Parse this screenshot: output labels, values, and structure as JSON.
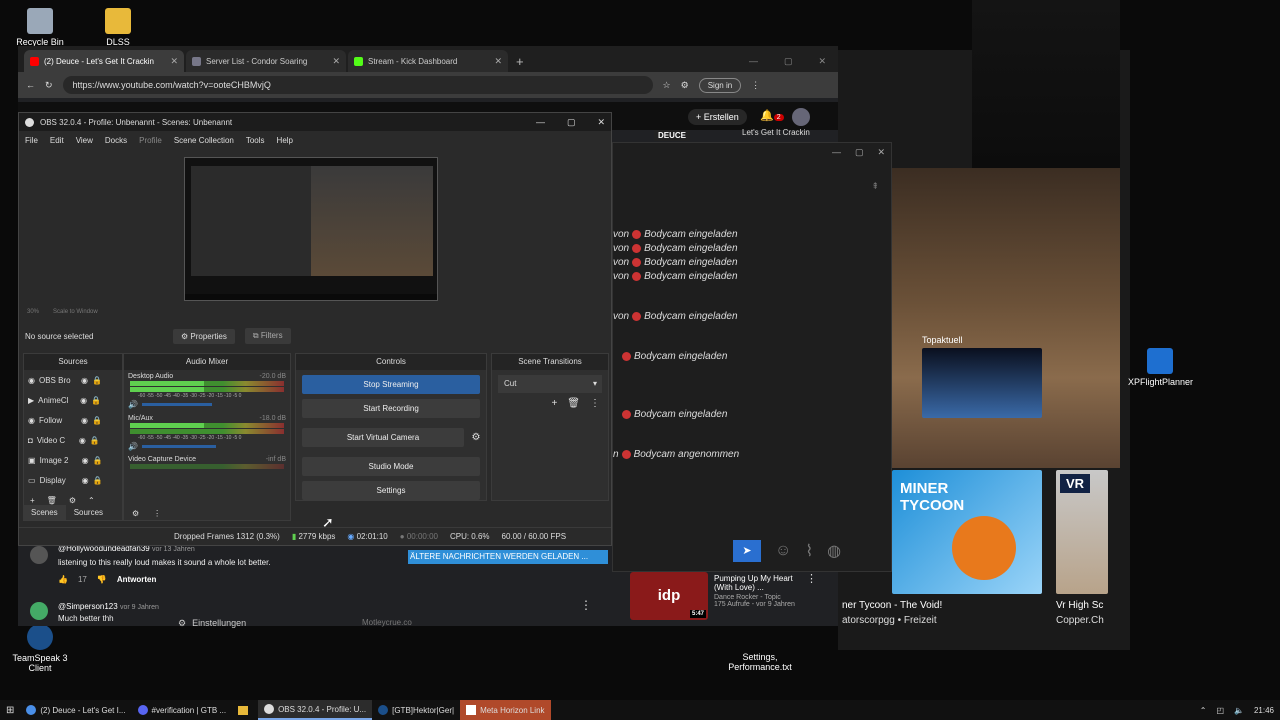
{
  "desktop": {
    "icons": [
      {
        "label": "Recycle Bin"
      },
      {
        "label": "DLSS"
      },
      {
        "label": "XPFlightPlanner"
      },
      {
        "label": "TeamSpeak 3 Client"
      },
      {
        "label": "Settings, Performance.txt"
      }
    ]
  },
  "browser": {
    "tabs": [
      {
        "label": "(2) Deuce - Let's Get It Crackin"
      },
      {
        "label": "Server List - Condor Soaring"
      },
      {
        "label": "Stream - Kick Dashboard"
      }
    ],
    "new_tab": "+",
    "url": "https://www.youtube.com/watch?v=ooteCHBMvjQ",
    "sign_in": "Sign in",
    "create_label": "Erstellen",
    "notif_count": "2",
    "comments": [
      {
        "user": "@Hollywoodundeadfan39",
        "age": "vor 13 Jahren",
        "text": "listening to this really loud makes it sound a whole lot better.",
        "likes": "17",
        "reply": "Antworten"
      },
      {
        "user": "@Simperson123",
        "age": "vor 9 Jahren",
        "text": "Much better thh"
      }
    ],
    "settings_label": "Einstellungen",
    "video_top": {
      "channel": "DEUCE",
      "title": "Let's Get It Crackin"
    },
    "related": {
      "title": "Pumping Up My Heart (With Love) ...",
      "channel": "Dance Rocker - Topic",
      "views": "175 Aufrufe - vor 9 Jahren",
      "duration": "5:47",
      "badge": "idp"
    }
  },
  "obs": {
    "title": "OBS 32.0.4 - Profile: Unbenannt - Scenes: Unbenannt",
    "menu": [
      "File",
      "Edit",
      "View",
      "Docks",
      "Profile",
      "Scene Collection",
      "Tools",
      "Help"
    ],
    "preview_footer": {
      "zoom": "30%",
      "scale": "Scale to Window"
    },
    "no_source": "No source selected",
    "properties": "Properties",
    "filters": "Filters",
    "docks": {
      "sources": "Sources",
      "audio_mixer": "Audio Mixer",
      "controls": "Controls",
      "scene_transitions": "Scene Transitions"
    },
    "sources": [
      {
        "label": "OBS Bro"
      },
      {
        "label": "AnimeCl"
      },
      {
        "label": "Follow"
      },
      {
        "label": "Video C"
      },
      {
        "label": "Image 2"
      },
      {
        "label": "Display"
      }
    ],
    "mixer": [
      {
        "name": "Desktop Audio",
        "db": "-20.0 dB"
      },
      {
        "name": "Mic/Aux",
        "db": "-18.0 dB"
      },
      {
        "name": "Video Capture Device",
        "db": "-inf dB"
      }
    ],
    "meter_scale": "-60 -55 -50 -45 -40 -35 -30 -25 -20 -15 -10 -5 0",
    "controls": {
      "stop_streaming": "Stop Streaming",
      "start_recording": "Start Recording",
      "start_virtual_camera": "Start Virtual Camera",
      "studio_mode": "Studio Mode",
      "settings": "Settings"
    },
    "transition": "Cut",
    "tabs": {
      "scenes": "Scenes",
      "sources": "Sources"
    },
    "status": {
      "dropped": "Dropped Frames 1312 (0.3%)",
      "kbps": "2779 kbps",
      "stream_time": "02:01:10",
      "rec_time": "00:00:00",
      "cpu": "CPU: 0.6%",
      "fps": "60.00 / 60.00 FPS"
    }
  },
  "chat": {
    "lines": [
      {
        "prefix": "von",
        "text": "Bodycam eingeladen"
      },
      {
        "prefix": "von",
        "text": "Bodycam eingeladen"
      },
      {
        "prefix": "von",
        "text": "Bodycam eingeladen"
      },
      {
        "prefix": "von",
        "text": "Bodycam eingeladen"
      },
      {
        "prefix": "von",
        "text": "Bodycam eingeladen"
      },
      {
        "prefix": "",
        "text": "Bodycam eingeladen"
      },
      {
        "prefix": "",
        "text": "Bodycam eingeladen"
      },
      {
        "prefix": "n",
        "text": "Bodycam angenommen"
      }
    ],
    "loading_banner": "ÄLTERE NACHRICHTEN WERDEN GELADEN ..."
  },
  "right_panel": {
    "topaktuell": "Topaktuell",
    "videos": [
      {
        "title": "ner Tycoon - The Void!",
        "channel": "atorscorpgg • Freizeit",
        "art": "MINER TYCOON"
      },
      {
        "title": "Vr High Sc",
        "channel": "Copper.Ch",
        "art": "VR"
      }
    ],
    "bg_caption": "Motleycrue.co"
  },
  "taskbar": {
    "items": [
      {
        "label": "(2) Deuce - Let's Get I..."
      },
      {
        "label": "#verification | GTB ..."
      },
      {
        "label": ""
      },
      {
        "label": "OBS 32.0.4 - Profile: U..."
      },
      {
        "label": "[GTB]Hektor|Ger|"
      },
      {
        "label": "Meta Horizon Link"
      }
    ],
    "time": "21:46"
  },
  "colors": {
    "accent": "#2a5fa0",
    "youtube_red": "#ff0000",
    "kick_green": "#53fc18",
    "taskbar": "#111111"
  }
}
